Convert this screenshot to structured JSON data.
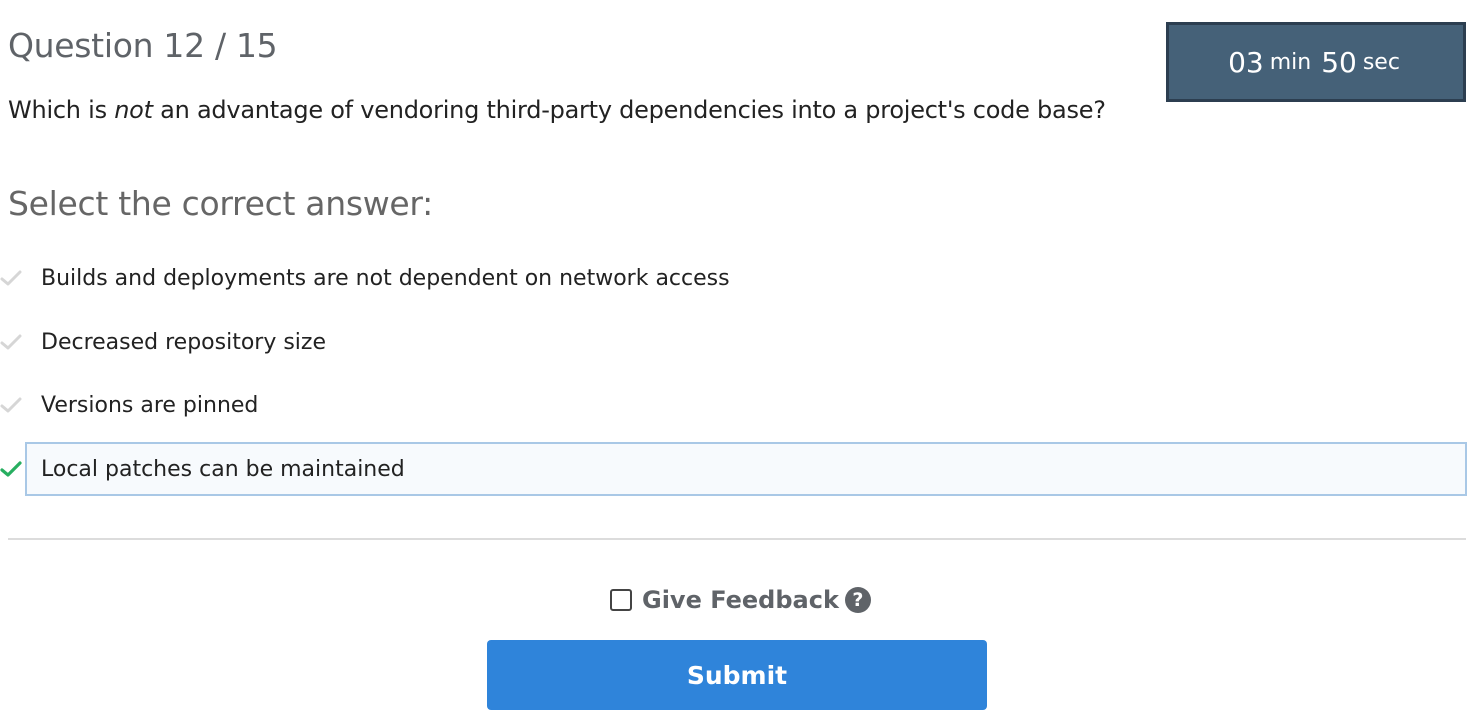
{
  "header": {
    "question_counter": "Question 12 / 15"
  },
  "timer": {
    "minutes": "03",
    "minutes_unit": "min",
    "seconds": "50",
    "seconds_unit": "sec"
  },
  "question": {
    "text_before": "Which is ",
    "text_emphasis": "not",
    "text_after": " an advantage of vendoring third-party dependencies into a project's code base?"
  },
  "prompt": {
    "heading": "Select the correct answer:"
  },
  "answers": [
    {
      "label": "Builds and deployments are not dependent on network access",
      "selected": false
    },
    {
      "label": "Decreased repository size",
      "selected": false
    },
    {
      "label": "Versions are pinned",
      "selected": false
    },
    {
      "label": "Local patches can be maintained",
      "selected": true
    }
  ],
  "feedback": {
    "label": "Give Feedback",
    "checked": false,
    "help_icon": "question-circle-icon"
  },
  "submit": {
    "label": "Submit"
  },
  "colors": {
    "timer_bg": "#456178",
    "selected_check": "#27ae60",
    "unselected_check": "#d6d6d6",
    "submit_bg": "#2f84da"
  }
}
